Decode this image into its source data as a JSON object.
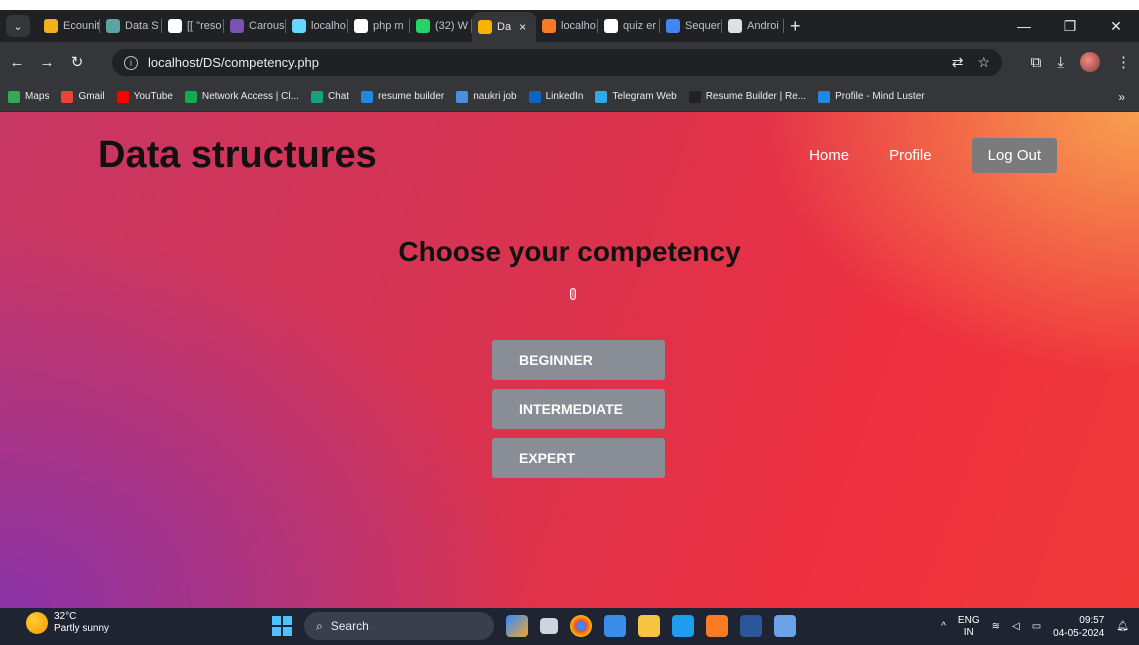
{
  "browser": {
    "tabs": [
      {
        "label": "Ecounit",
        "favicon_color": "#f2b01e",
        "favicon_icon": "figma-icon"
      },
      {
        "label": "Data S",
        "favicon_color": "#5ea3a3",
        "favicon_icon": "data-icon"
      },
      {
        "label": "[[ \"reso",
        "favicon_color": "#ffffff",
        "favicon_icon": "google-icon"
      },
      {
        "label": "Carous",
        "favicon_color": "#7952b3",
        "favicon_icon": "bootstrap-icon"
      },
      {
        "label": "localho",
        "favicon_color": "#61dafb",
        "favicon_icon": "react-icon"
      },
      {
        "label": "php m",
        "favicon_color": "#ffffff",
        "favicon_icon": "google-icon"
      },
      {
        "label": "(32) W",
        "favicon_color": "#25d366",
        "favicon_icon": "whatsapp-icon"
      },
      {
        "label": "Da",
        "favicon_color": "#f4b400",
        "favicon_icon": "site-icon",
        "active": true
      },
      {
        "label": "localho",
        "favicon_color": "#fb7a24",
        "favicon_icon": "xampp-icon"
      },
      {
        "label": "quiz er",
        "favicon_color": "#ffffff",
        "favicon_icon": "google-icon"
      },
      {
        "label": "Sequer",
        "favicon_color": "#4285f4",
        "favicon_icon": "sequence-icon"
      },
      {
        "label": "Androi",
        "favicon_color": "#e0e0e0",
        "favicon_icon": "android-icon"
      }
    ],
    "url": "localhost/DS/competency.php",
    "bookmarks": [
      {
        "label": "Maps",
        "color": "#34a853",
        "icon": "maps-icon"
      },
      {
        "label": "Gmail",
        "color": "#ea4335",
        "icon": "gmail-icon"
      },
      {
        "label": "YouTube",
        "color": "#ff0000",
        "icon": "youtube-icon"
      },
      {
        "label": "Network Access | Cl...",
        "color": "#13aa52",
        "icon": "mongodb-icon"
      },
      {
        "label": "Chat",
        "color": "#10a37f",
        "icon": "chatgpt-icon"
      },
      {
        "label": "resume builder",
        "color": "#1e88e5",
        "icon": "n-icon"
      },
      {
        "label": "naukri job",
        "color": "#4a90e2",
        "icon": "naukri-icon"
      },
      {
        "label": "LinkedIn",
        "color": "#0a66c2",
        "icon": "linkedin-icon"
      },
      {
        "label": "Telegram Web",
        "color": "#2aabee",
        "icon": "telegram-icon"
      },
      {
        "label": "Resume Builder | Re...",
        "color": "#222222",
        "icon": "resume-icon"
      },
      {
        "label": "Profile - Mind Luster",
        "color": "#1e88e5",
        "icon": "m-icon"
      }
    ]
  },
  "page": {
    "site_title": "Data structures",
    "nav": {
      "home": "Home",
      "profile": "Profile",
      "logout": "Log Out"
    },
    "heading": "Choose your competency",
    "levels": [
      "BEGINNER",
      "INTERMEDIATE",
      "EXPERT"
    ]
  },
  "taskbar": {
    "weather_temp": "32°C",
    "weather_desc": "Partly sunny",
    "search_placeholder": "Search",
    "lang_top": "ENG",
    "lang_bottom": "IN",
    "time": "09:57",
    "date": "04-05-2024"
  },
  "colors": {
    "button_bg": "#898e96",
    "logout_bg": "#7b7b7b",
    "gradient_start": "#8a33a8",
    "gradient_mid": "#d9334f",
    "gradient_end": "#f7a04f"
  }
}
